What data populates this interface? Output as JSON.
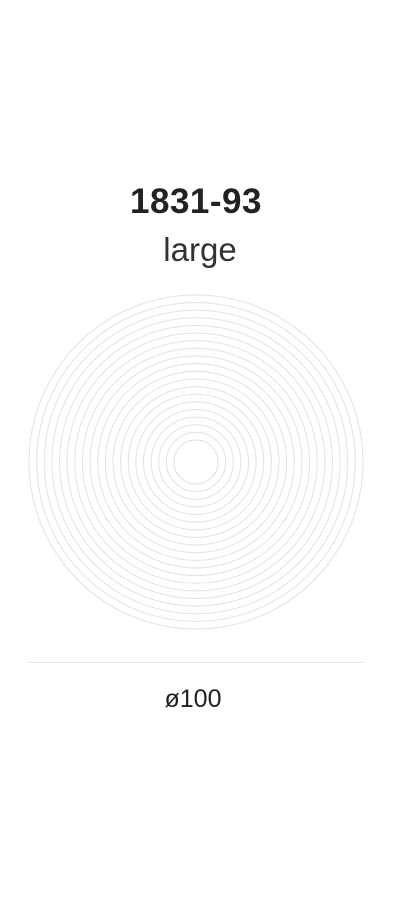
{
  "product": {
    "code": "1831-93",
    "size_label": "large",
    "dimension": "ø100"
  },
  "illustration": {
    "name": "concentric-rings",
    "ring_count": 20,
    "stroke_color": "#e2e2e2"
  }
}
